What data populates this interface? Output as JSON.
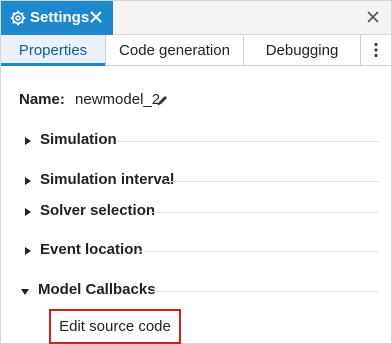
{
  "window": {
    "title": "Settings",
    "accent_color": "#1e88cf",
    "highlight_color": "#d21f1f"
  },
  "tabs": [
    {
      "label": "Properties",
      "active": true
    },
    {
      "label": "Code generation",
      "active": false
    },
    {
      "label": "Debugging",
      "active": false
    }
  ],
  "name_row": {
    "label": "Name:",
    "value": "newmodel_2"
  },
  "sections": [
    {
      "label": "Simulation",
      "expanded": false
    },
    {
      "label": "Simulation interval",
      "expanded": false
    },
    {
      "label": "Solver selection",
      "expanded": false
    },
    {
      "label": "Event location",
      "expanded": false
    },
    {
      "label": "Model Callbacks",
      "expanded": true
    }
  ],
  "model_callbacks": {
    "edit_button_label": "Edit source code"
  }
}
